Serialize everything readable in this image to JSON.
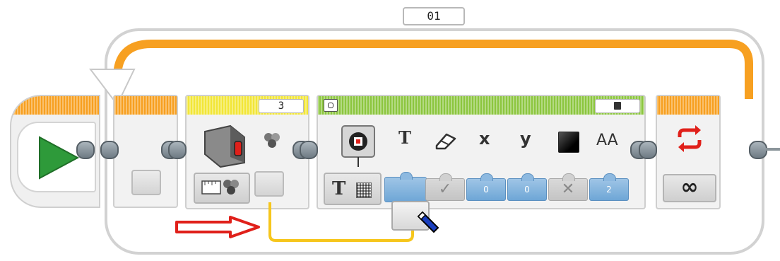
{
  "loop": {
    "name_value": "01",
    "mode_symbol": "∞"
  },
  "sensor_block": {
    "port_value": "3"
  },
  "display_block": {
    "param_labels": [
      "T",
      "x",
      "y",
      "AA"
    ],
    "text_type_symbol": "T",
    "values": {
      "x": "0",
      "y": "0",
      "font": "2"
    }
  },
  "colors": {
    "loop_orange": "#f7a021",
    "flow_yellow": "#f6c61c",
    "display_green": "#8cc63f",
    "sensor_yellow": "#f2e638",
    "start_green": "#2e9a3a",
    "arrow_red": "#e0201a",
    "param_blue": "#6ea6d6"
  }
}
